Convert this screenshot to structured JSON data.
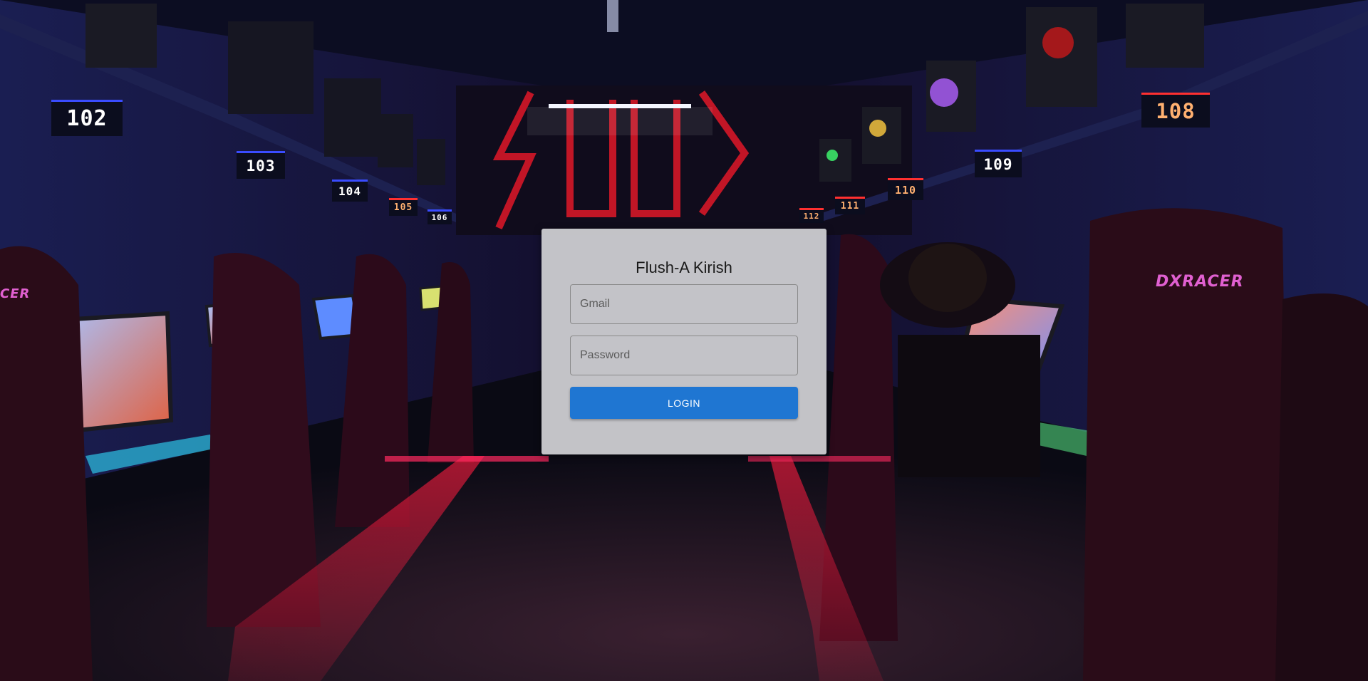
{
  "login": {
    "title": "Flush-A Kirish",
    "email_placeholder": "Gmail",
    "password_placeholder": "Password",
    "button_label": "LOGIN"
  },
  "background": {
    "seat_numbers_left": [
      "102",
      "103",
      "104",
      "105",
      "106"
    ],
    "seat_numbers_right": [
      "108",
      "109",
      "110",
      "111",
      "112"
    ],
    "chair_brand": "DXRACER",
    "chair_brand_left": "CER"
  }
}
